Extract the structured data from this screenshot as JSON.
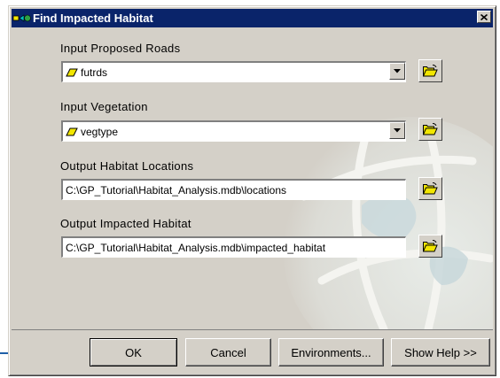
{
  "window": {
    "title": "Find Impacted Habitat",
    "close_symbol": "×"
  },
  "fields": [
    {
      "label": "Input Proposed Roads",
      "value": "futrds",
      "kind": "dropdown",
      "icon": "polygon-layer-icon"
    },
    {
      "label": "Input Vegetation",
      "value": "vegtype",
      "kind": "dropdown",
      "icon": "polygon-layer-icon"
    },
    {
      "label": "Output Habitat Locations",
      "value": "C:\\GP_Tutorial\\Habitat_Analysis.mdb\\locations",
      "kind": "text"
    },
    {
      "label": "Output Impacted Habitat",
      "value": "C:\\GP_Tutorial\\Habitat_Analysis.mdb\\impacted_habitat",
      "kind": "text"
    }
  ],
  "buttons": {
    "ok": "OK",
    "cancel": "Cancel",
    "environments": "Environments...",
    "show_help": "Show Help >>"
  },
  "icons": {
    "title": "model-tool-icon",
    "browse": "open-folder-icon",
    "dropdown": "down-arrow-icon"
  },
  "colors": {
    "title_bar": "#0a246a",
    "dialog_face": "#d4d0c8",
    "layer_icon": "#f2e600",
    "callout_line": "#1f5fa8"
  }
}
